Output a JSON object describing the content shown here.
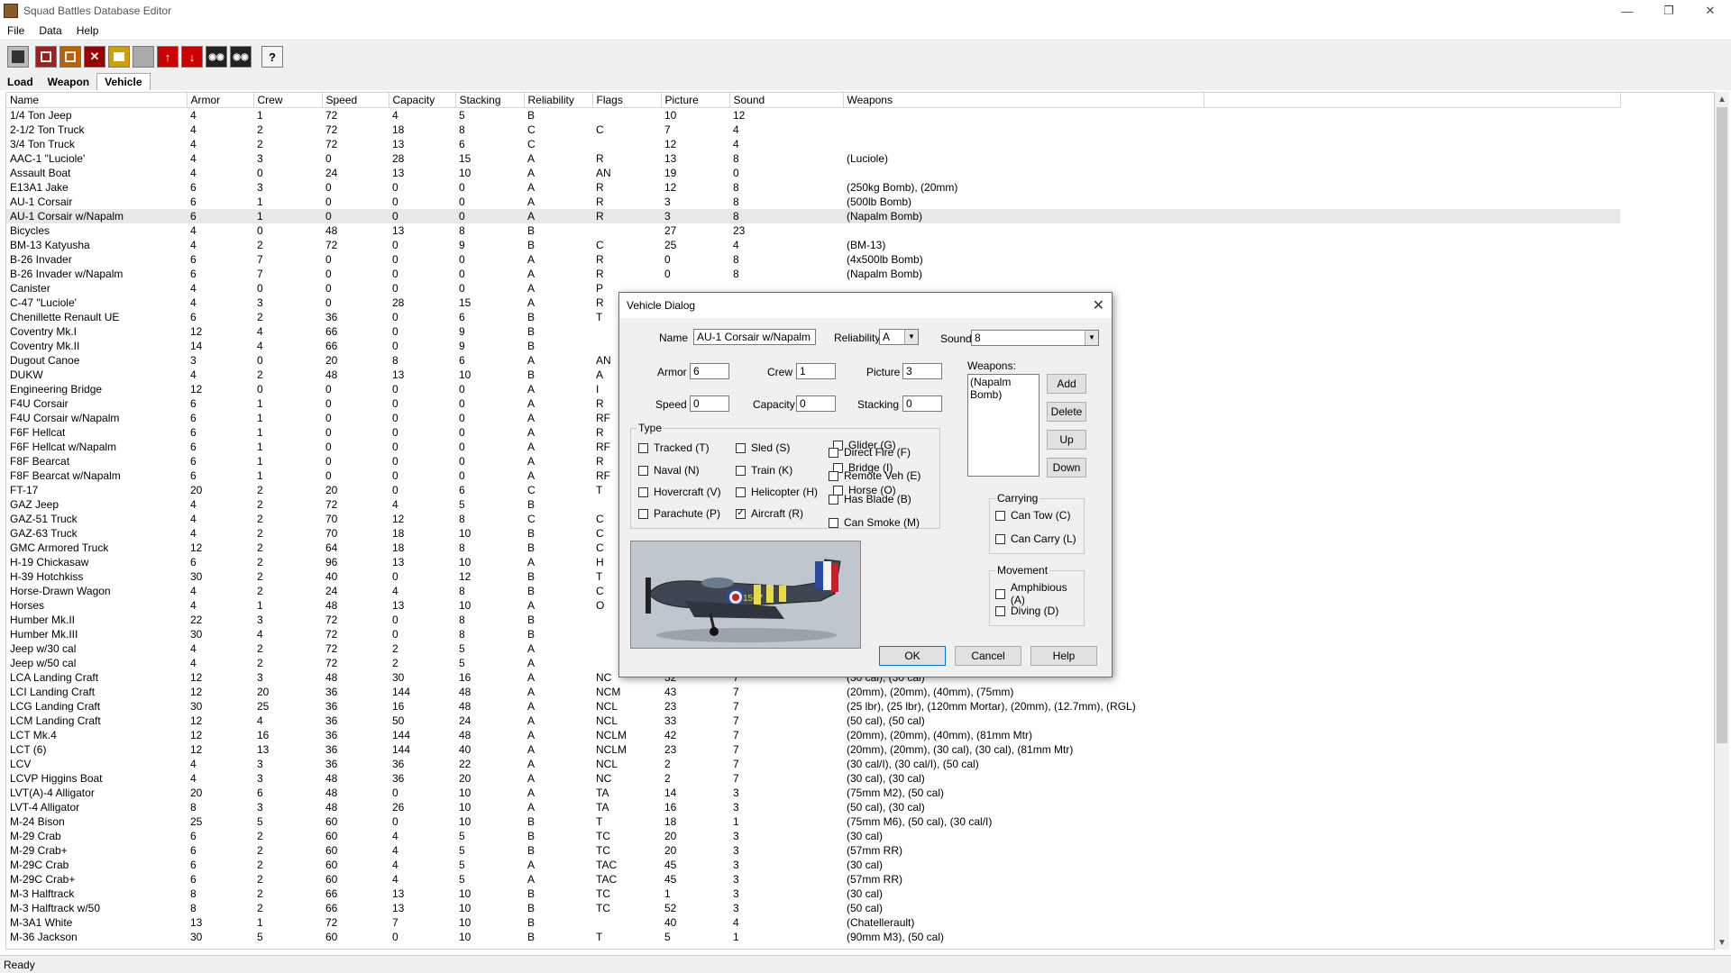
{
  "window": {
    "title": "Squad Battles Database Editor"
  },
  "menu": [
    "File",
    "Data",
    "Help"
  ],
  "toolbar": {
    "icons": [
      "save-icon",
      "open-icon",
      "new-icon",
      "delete-icon",
      "edit-icon",
      "blank-icon",
      "move-up-icon",
      "move-down-icon",
      "view-icon",
      "view2-icon",
      "help-icon"
    ],
    "help_label": "?"
  },
  "tabs": [
    "Load",
    "Weapon",
    "Vehicle"
  ],
  "grid": {
    "columns": [
      "Name",
      "Armor",
      "Crew",
      "Speed",
      "Capacity",
      "Stacking",
      "Reliability",
      "Flags",
      "Picture",
      "Sound",
      "Weapons"
    ],
    "rows": [
      [
        "1/4 Ton Jeep",
        "4",
        "1",
        "72",
        "4",
        "5",
        "B",
        "",
        "10",
        "12",
        ""
      ],
      [
        "2-1/2 Ton Truck",
        "4",
        "2",
        "72",
        "18",
        "8",
        "C",
        "C",
        "7",
        "4",
        ""
      ],
      [
        "3/4 Ton Truck",
        "4",
        "2",
        "72",
        "13",
        "6",
        "C",
        "",
        "12",
        "4",
        ""
      ],
      [
        "AAC-1 \"Luciole'",
        "4",
        "3",
        "0",
        "28",
        "15",
        "A",
        "R",
        "13",
        "8",
        "(Luciole)"
      ],
      [
        "Assault Boat",
        "4",
        "0",
        "24",
        "13",
        "10",
        "A",
        "AN",
        "19",
        "0",
        ""
      ],
      [
        "E13A1 Jake",
        "6",
        "3",
        "0",
        "0",
        "0",
        "A",
        "R",
        "12",
        "8",
        "(250kg Bomb), (20mm)"
      ],
      [
        "AU-1 Corsair",
        "6",
        "1",
        "0",
        "0",
        "0",
        "A",
        "R",
        "3",
        "8",
        "(500lb Bomb)"
      ],
      [
        "AU-1 Corsair w/Napalm",
        "6",
        "1",
        "0",
        "0",
        "0",
        "A",
        "R",
        "3",
        "8",
        "(Napalm Bomb)"
      ],
      [
        "Bicycles",
        "4",
        "0",
        "48",
        "13",
        "8",
        "B",
        "",
        "27",
        "23",
        ""
      ],
      [
        "BM-13 Katyusha",
        "4",
        "2",
        "72",
        "0",
        "9",
        "B",
        "C",
        "25",
        "4",
        "(BM-13)"
      ],
      [
        "B-26 Invader",
        "6",
        "7",
        "0",
        "0",
        "0",
        "A",
        "R",
        "0",
        "8",
        "(4x500lb Bomb)"
      ],
      [
        "B-26 Invader w/Napalm",
        "6",
        "7",
        "0",
        "0",
        "0",
        "A",
        "R",
        "0",
        "8",
        "(Napalm Bomb)"
      ],
      [
        "Canister",
        "4",
        "0",
        "0",
        "0",
        "0",
        "A",
        "P",
        "",
        "",
        ""
      ],
      [
        "C-47 \"Luciole'",
        "4",
        "3",
        "0",
        "28",
        "15",
        "A",
        "R",
        "",
        "",
        ""
      ],
      [
        "Chenillette Renault UE",
        "6",
        "2",
        "36",
        "0",
        "6",
        "B",
        "T",
        "",
        "",
        ""
      ],
      [
        "Coventry Mk.I",
        "12",
        "4",
        "66",
        "0",
        "9",
        "B",
        "",
        "",
        "",
        ""
      ],
      [
        "Coventry Mk.II",
        "14",
        "4",
        "66",
        "0",
        "9",
        "B",
        "",
        "",
        "",
        ""
      ],
      [
        "Dugout Canoe",
        "3",
        "0",
        "20",
        "8",
        "6",
        "A",
        "AN",
        "",
        "",
        ""
      ],
      [
        "DUKW",
        "4",
        "2",
        "48",
        "13",
        "10",
        "B",
        "A",
        "",
        "",
        ""
      ],
      [
        "Engineering Bridge",
        "12",
        "0",
        "0",
        "0",
        "0",
        "A",
        "I",
        "",
        "",
        ""
      ],
      [
        "F4U Corsair",
        "6",
        "1",
        "0",
        "0",
        "0",
        "A",
        "R",
        "",
        "",
        ""
      ],
      [
        "F4U Corsair w/Napalm",
        "6",
        "1",
        "0",
        "0",
        "0",
        "A",
        "RF",
        "",
        "",
        ""
      ],
      [
        "F6F Hellcat",
        "6",
        "1",
        "0",
        "0",
        "0",
        "A",
        "R",
        "",
        "",
        ""
      ],
      [
        "F6F Hellcat w/Napalm",
        "6",
        "1",
        "0",
        "0",
        "0",
        "A",
        "RF",
        "",
        "",
        ""
      ],
      [
        "F8F Bearcat",
        "6",
        "1",
        "0",
        "0",
        "0",
        "A",
        "R",
        "",
        "",
        ""
      ],
      [
        "F8F Bearcat w/Napalm",
        "6",
        "1",
        "0",
        "0",
        "0",
        "A",
        "RF",
        "",
        "",
        ""
      ],
      [
        "FT-17",
        "20",
        "2",
        "20",
        "0",
        "6",
        "C",
        "T",
        "",
        "",
        ""
      ],
      [
        "GAZ Jeep",
        "4",
        "2",
        "72",
        "4",
        "5",
        "B",
        "",
        "",
        "",
        ""
      ],
      [
        "GAZ-51 Truck",
        "4",
        "2",
        "70",
        "12",
        "8",
        "C",
        "C",
        "",
        "",
        ""
      ],
      [
        "GAZ-63 Truck",
        "4",
        "2",
        "70",
        "18",
        "10",
        "B",
        "C",
        "",
        "",
        ""
      ],
      [
        "GMC Armored Truck",
        "12",
        "2",
        "64",
        "18",
        "8",
        "B",
        "C",
        "",
        "",
        ""
      ],
      [
        "H-19 Chickasaw",
        "6",
        "2",
        "96",
        "13",
        "10",
        "A",
        "H",
        "",
        "",
        ""
      ],
      [
        "H-39 Hotchkiss",
        "30",
        "2",
        "40",
        "0",
        "12",
        "B",
        "T",
        "",
        "",
        ""
      ],
      [
        "Horse-Drawn Wagon",
        "4",
        "2",
        "24",
        "4",
        "8",
        "B",
        "C",
        "",
        "",
        ""
      ],
      [
        "Horses",
        "4",
        "1",
        "48",
        "13",
        "10",
        "A",
        "O",
        "",
        "",
        ""
      ],
      [
        "Humber Mk.II",
        "22",
        "3",
        "72",
        "0",
        "8",
        "B",
        "",
        "",
        "",
        ""
      ],
      [
        "Humber Mk.III",
        "30",
        "4",
        "72",
        "0",
        "8",
        "B",
        "",
        "",
        "",
        ""
      ],
      [
        "Jeep w/30 cal",
        "4",
        "2",
        "72",
        "2",
        "5",
        "A",
        "",
        "",
        "",
        ""
      ],
      [
        "Jeep w/50 cal",
        "4",
        "2",
        "72",
        "2",
        "5",
        "A",
        "",
        "",
        "",
        ""
      ],
      [
        "LCA Landing Craft",
        "12",
        "3",
        "48",
        "30",
        "16",
        "A",
        "NC",
        "32",
        "7",
        "(30 cal), (30 cal)"
      ],
      [
        "LCI Landing Craft",
        "12",
        "20",
        "36",
        "144",
        "48",
        "A",
        "NCM",
        "43",
        "7",
        "(20mm), (20mm), (40mm), (75mm)"
      ],
      [
        "LCG Landing Craft",
        "30",
        "25",
        "36",
        "16",
        "48",
        "A",
        "NCL",
        "23",
        "7",
        "(25 lbr), (25 lbr), (120mm Mortar), (20mm), (12.7mm), (RGL)"
      ],
      [
        "LCM Landing Craft",
        "12",
        "4",
        "36",
        "50",
        "24",
        "A",
        "NCL",
        "33",
        "7",
        "(50 cal), (50 cal)"
      ],
      [
        "LCT Mk.4",
        "12",
        "16",
        "36",
        "144",
        "48",
        "A",
        "NCLM",
        "42",
        "7",
        "(20mm), (20mm), (40mm), (81mm Mtr)"
      ],
      [
        "LCT (6)",
        "12",
        "13",
        "36",
        "144",
        "40",
        "A",
        "NCLM",
        "23",
        "7",
        "(20mm), (20mm), (30 cal), (30 cal), (81mm Mtr)"
      ],
      [
        "LCV",
        "4",
        "3",
        "36",
        "36",
        "22",
        "A",
        "NCL",
        "2",
        "7",
        "(30 cal/I), (30 cal/I), (50 cal)"
      ],
      [
        "LCVP Higgins Boat",
        "4",
        "3",
        "48",
        "36",
        "20",
        "A",
        "NC",
        "2",
        "7",
        "(30 cal), (30 cal)"
      ],
      [
        "LVT(A)-4 Alligator",
        "20",
        "6",
        "48",
        "0",
        "10",
        "A",
        "TA",
        "14",
        "3",
        "(75mm M2), (50 cal)"
      ],
      [
        "LVT-4 Alligator",
        "8",
        "3",
        "48",
        "26",
        "10",
        "A",
        "TA",
        "16",
        "3",
        "(50 cal), (30 cal)"
      ],
      [
        "M-24 Bison",
        "25",
        "5",
        "60",
        "0",
        "10",
        "B",
        "T",
        "18",
        "1",
        "(75mm M6), (50 cal), (30 cal/I)"
      ],
      [
        "M-29 Crab",
        "6",
        "2",
        "60",
        "4",
        "5",
        "B",
        "TC",
        "20",
        "3",
        "(30 cal)"
      ],
      [
        "M-29 Crab+",
        "6",
        "2",
        "60",
        "4",
        "5",
        "B",
        "TC",
        "20",
        "3",
        "(57mm RR)"
      ],
      [
        "M-29C Crab",
        "6",
        "2",
        "60",
        "4",
        "5",
        "A",
        "TAC",
        "45",
        "3",
        "(30 cal)"
      ],
      [
        "M-29C Crab+",
        "6",
        "2",
        "60",
        "4",
        "5",
        "A",
        "TAC",
        "45",
        "3",
        "(57mm RR)"
      ],
      [
        "M-3 Halftrack",
        "8",
        "2",
        "66",
        "13",
        "10",
        "B",
        "TC",
        "1",
        "3",
        "(30 cal)"
      ],
      [
        "M-3 Halftrack w/50",
        "8",
        "2",
        "66",
        "13",
        "10",
        "B",
        "TC",
        "52",
        "3",
        "(50 cal)"
      ],
      [
        "M-3A1 White",
        "13",
        "1",
        "72",
        "7",
        "10",
        "B",
        "",
        "40",
        "4",
        "(Chatellerault)"
      ],
      [
        "M-36 Jackson",
        "30",
        "5",
        "60",
        "0",
        "10",
        "B",
        "T",
        "5",
        "1",
        "(90mm M3), (50 cal)"
      ]
    ],
    "selected_row_index": 7
  },
  "dialog": {
    "title": "Vehicle Dialog",
    "name_label": "Name",
    "name_value": "AU-1 Corsair w/Napalm",
    "reliability_label": "Reliability",
    "reliability_value": "A",
    "sound_label": "Sound",
    "sound_value": "8",
    "armor_label": "Armor",
    "armor_value": "6",
    "crew_label": "Crew",
    "crew_value": "1",
    "picture_label": "Picture",
    "picture_value": "3",
    "speed_label": "Speed",
    "speed_value": "0",
    "capacity_label": "Capacity",
    "capacity_value": "0",
    "stacking_label": "Stacking",
    "stacking_value": "0",
    "weapons_label": "Weapons:",
    "weapons": [
      "(Napalm Bomb)"
    ],
    "add_label": "Add",
    "delete_label": "Delete",
    "up_label": "Up",
    "down_label": "Down",
    "type_label": "Type",
    "types": [
      {
        "label": "Tracked (T)",
        "checked": false
      },
      {
        "label": "Sled (S)",
        "checked": false
      },
      {
        "label": "Glider (G)",
        "checked": false
      },
      {
        "label": "Naval (N)",
        "checked": false
      },
      {
        "label": "Train (K)",
        "checked": false
      },
      {
        "label": "Bridge (I)",
        "checked": false
      },
      {
        "label": "Hovercraft (V)",
        "checked": false
      },
      {
        "label": "Helicopter (H)",
        "checked": false
      },
      {
        "label": "Horse (O)",
        "checked": false
      },
      {
        "label": "Parachute (P)",
        "checked": false
      },
      {
        "label": "Aircraft (R)",
        "checked": true
      }
    ],
    "flags": [
      {
        "label": "Direct Fire (F)",
        "checked": false
      },
      {
        "label": "Remote Veh (E)",
        "checked": false
      },
      {
        "label": "Has Blade (B)",
        "checked": false
      },
      {
        "label": "Can Smoke (M)",
        "checked": false
      }
    ],
    "carrying_label": "Carrying",
    "carrying": [
      {
        "label": "Can Tow (C)",
        "checked": false
      },
      {
        "label": "Can Carry (L)",
        "checked": false
      }
    ],
    "movement_label": "Movement",
    "movement": [
      {
        "label": "Amphibious (A)",
        "checked": false
      },
      {
        "label": "Diving (D)",
        "checked": false
      }
    ],
    "ok_label": "OK",
    "cancel_label": "Cancel",
    "help_label": "Help",
    "check_mark": "✓",
    "picture_tail_marks": "1567"
  },
  "status": {
    "text": "Ready"
  }
}
